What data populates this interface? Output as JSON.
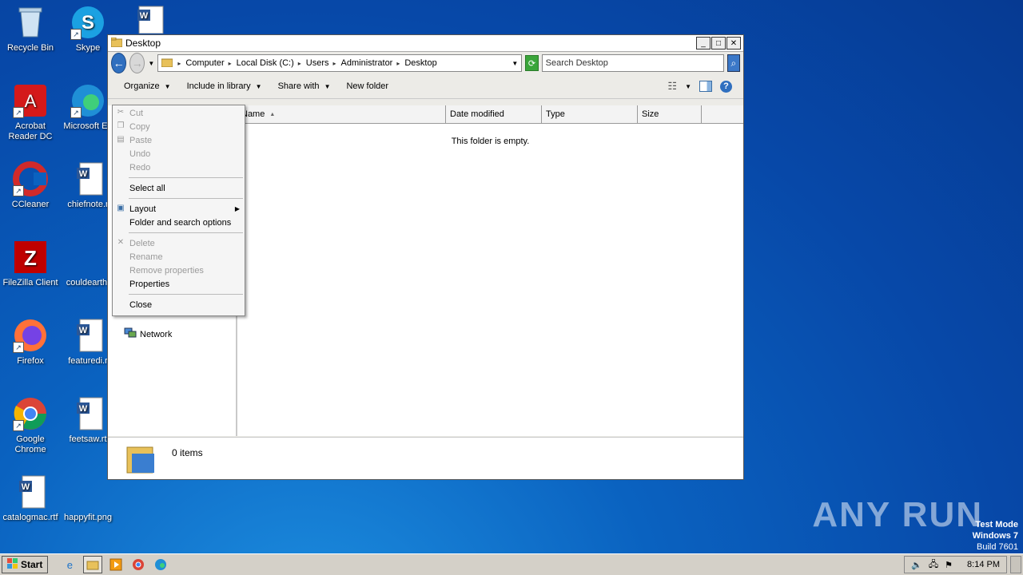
{
  "desktop": {
    "icons": [
      {
        "label": "Recycle Bin",
        "icon": "recycle-bin-icon"
      },
      {
        "label": "Skype",
        "icon": "skype-icon"
      },
      {
        "label": "Acrobat Reader DC",
        "icon": "acrobat-icon"
      },
      {
        "label": "Microsoft Ed",
        "icon": "edge-icon"
      },
      {
        "label": "CCleaner",
        "icon": "ccleaner-icon"
      },
      {
        "label": "chiefnote.r",
        "icon": "word-doc-icon"
      },
      {
        "label": "FileZilla Client",
        "icon": "filezilla-icon"
      },
      {
        "label": "couldearth.",
        "icon": "blank-file-icon"
      },
      {
        "label": "Firefox",
        "icon": "firefox-icon"
      },
      {
        "label": "featuredi.r",
        "icon": "word-doc-icon"
      },
      {
        "label": "Google Chrome",
        "icon": "chrome-icon"
      },
      {
        "label": "feetsaw.rt",
        "icon": "word-doc-icon"
      },
      {
        "label": "catalogmac.rtf",
        "icon": "word-doc-icon"
      },
      {
        "label": "happyfit.png",
        "icon": "image-file-icon"
      }
    ]
  },
  "window": {
    "title": "Desktop",
    "breadcrumbs": [
      "Computer",
      "Local Disk (C:)",
      "Users",
      "Administrator",
      "Desktop"
    ],
    "search_placeholder": "Search Desktop",
    "toolbar": {
      "organize": "Organize",
      "include_in_library": "Include in library",
      "share_with": "Share with",
      "new_folder": "New folder"
    },
    "columns": [
      "Name",
      "Date modified",
      "Type",
      "Size"
    ],
    "empty_message": "This folder is empty.",
    "nav_network": "Network",
    "status_count": "0 items"
  },
  "organize_menu": {
    "cut": "Cut",
    "copy": "Copy",
    "paste": "Paste",
    "undo": "Undo",
    "redo": "Redo",
    "select_all": "Select all",
    "layout": "Layout",
    "folder_options": "Folder and search options",
    "delete": "Delete",
    "rename": "Rename",
    "remove_properties": "Remove properties",
    "properties": "Properties",
    "close": "Close"
  },
  "taskbar": {
    "start": "Start",
    "clock": "8:14 PM"
  },
  "watermark": "ANY RUN",
  "system_overlay": {
    "line1": "Test Mode",
    "line2": "Windows 7",
    "line3": "Build 7601"
  }
}
